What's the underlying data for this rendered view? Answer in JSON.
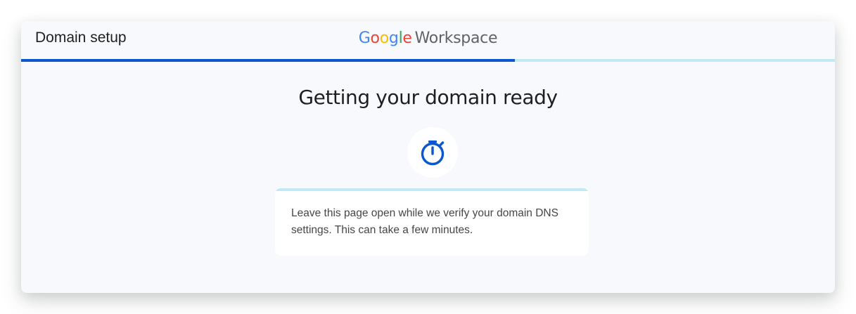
{
  "header": {
    "title": "Domain setup",
    "logo": {
      "letters": [
        {
          "char": "G",
          "color": "#4285F4"
        },
        {
          "char": "o",
          "color": "#EA4335"
        },
        {
          "char": "o",
          "color": "#FBBC05"
        },
        {
          "char": "g",
          "color": "#4285F4"
        },
        {
          "char": "l",
          "color": "#34A853"
        },
        {
          "char": "e",
          "color": "#EA4335"
        }
      ],
      "product": "Workspace"
    }
  },
  "progress": {
    "fraction": 0.607,
    "fill_color": "#0b57d0",
    "track_color": "#c2e7f5"
  },
  "main": {
    "title": "Getting your domain ready",
    "status_icon": "timer-icon",
    "message": "Leave this page open while we verify your domain DNS settings. This can take a few minutes."
  }
}
